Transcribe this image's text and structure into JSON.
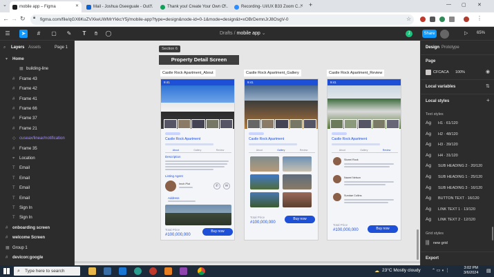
{
  "browser": {
    "tabs": [
      {
        "title": "mobile app – Figma",
        "color": "#1e1e1e"
      },
      {
        "title": "Mail - Joshua Oseeguale - Out...",
        "color": "#0a64d6"
      },
      {
        "title": "Thank you! Create Your Own C...",
        "color": "#0fa15a"
      },
      {
        "title": "Recording- UI/UX B33 Zoom C...",
        "color": "#2d8cff"
      }
    ],
    "url": "figma.com/file/qGX6KuZVXkeUWMrYkkcY5j/mobile-app?type=design&node-id=0-1&mode=design&t=xOBrDemnJrJ8OsgV-0"
  },
  "figma": {
    "breadcrumb_team": "Drafts",
    "breadcrumb_sep": "/",
    "file_name": "mobile app",
    "share_label": "Share",
    "zoom": "65%",
    "avatar_letter": "J"
  },
  "left_panel": {
    "tab_layers": "Layers",
    "tab_assets": "Assets",
    "page": "Page 1",
    "layers": [
      {
        "label": "Home",
        "indent": 0,
        "style": "bold",
        "icon": "▾"
      },
      {
        "label": "building-line",
        "indent": 2,
        "style": "",
        "icon": "▦"
      },
      {
        "label": "Frame 43",
        "indent": 1,
        "style": "",
        "icon": "#"
      },
      {
        "label": "Frame 42",
        "indent": 1,
        "style": "",
        "icon": "#"
      },
      {
        "label": "Frame 41",
        "indent": 1,
        "style": "",
        "icon": "#"
      },
      {
        "label": "Frame 66",
        "indent": 1,
        "style": "",
        "icon": "#"
      },
      {
        "label": "Frame 37",
        "indent": 1,
        "style": "",
        "icon": "#"
      },
      {
        "label": "Frame 21",
        "indent": 1,
        "style": "",
        "icon": "#"
      },
      {
        "label": "cuseax/linear/notification",
        "indent": 1,
        "style": "purple",
        "icon": "◇"
      },
      {
        "label": "Frame 35",
        "indent": 1,
        "style": "",
        "icon": "#"
      },
      {
        "label": "Location",
        "indent": 1,
        "style": "",
        "icon": "⌖"
      },
      {
        "label": "Email",
        "indent": 1,
        "style": "",
        "icon": "T"
      },
      {
        "label": "Email",
        "indent": 1,
        "style": "",
        "icon": "T"
      },
      {
        "label": "Email",
        "indent": 1,
        "style": "",
        "icon": "T"
      },
      {
        "label": "Email",
        "indent": 1,
        "style": "",
        "icon": "T"
      },
      {
        "label": "Sign In",
        "indent": 1,
        "style": "",
        "icon": "T"
      },
      {
        "label": "Sign In",
        "indent": 1,
        "style": "",
        "icon": "T"
      },
      {
        "label": "onboarding screen",
        "indent": 0,
        "style": "bold",
        "icon": "#"
      },
      {
        "label": "welcome Screen",
        "indent": 0,
        "style": "bold",
        "icon": "#"
      },
      {
        "label": "Group 1",
        "indent": 0,
        "style": "",
        "icon": "▦"
      },
      {
        "label": "devicon:google",
        "indent": 0,
        "style": "bold",
        "icon": "#"
      }
    ]
  },
  "canvas": {
    "section_label": "Section 6",
    "section_title": "Property Detail Screen",
    "frames": [
      {
        "label": "Castle Rock Apartment_About",
        "time": "9:41",
        "prop_name": "Castle Rock Apartment",
        "tabs": [
          "About",
          "Gallery",
          "Review"
        ],
        "active_tab": 0,
        "desc_head": "Description",
        "agent_head": "Listing Agent",
        "agent_name": "Imoh Plot",
        "address_head": "Address",
        "total_label": "Total Price",
        "price": "#100,000,000",
        "buy_label": "Buy now"
      },
      {
        "label": "Castle Rock Apartment_Gallery",
        "time": "9:41",
        "prop_name": "Castle Rock Apartment",
        "tabs": [
          "About",
          "Gallery",
          "Review"
        ],
        "active_tab": 1,
        "total_label": "Total Price",
        "price": "#100,000,000",
        "buy_label": "Buy now"
      },
      {
        "label": "Castle Rock Apartment_Review",
        "time": "9:41",
        "prop_name": "Castle Rock Apartment",
        "tabs": [
          "About",
          "Gallery",
          "Review"
        ],
        "active_tab": 2,
        "reviewers": [
          "Stormi Rock",
          "Naomi Nelson",
          "Sundae Collins"
        ],
        "total_label": "Total Price",
        "price": "#100,000,000",
        "buy_label": "Buy now"
      }
    ]
  },
  "right_panel": {
    "tab_design": "Design",
    "tab_prototype": "Prototype",
    "page_head": "Page",
    "page_color": "CFCACA",
    "page_opacity": "100%",
    "local_variables": "Local variables",
    "local_styles": "Local styles",
    "text_styles_head": "Text styles",
    "text_styles": [
      "H1 · 61/120",
      "H2 · 48/120",
      "H3 · 39/120",
      "H4 · 31/120",
      "SUB HEADING 2 · 20/120",
      "SUB HEADING 1 · 25/120",
      "SUB HEADING 3 · 16/120",
      "BUTTON TEXT · 16/120",
      "LINK TEXT 1 · 13/120",
      "LINK TEXT 2 · 12/120"
    ],
    "grid_head": "Grid styles",
    "grid_item": "new grid",
    "export": "Export"
  },
  "taskbar": {
    "search_placeholder": "Type here to search",
    "weather": "23°C  Mostly cloudy",
    "time": "3:02 PM",
    "date": "3/6/2024"
  }
}
